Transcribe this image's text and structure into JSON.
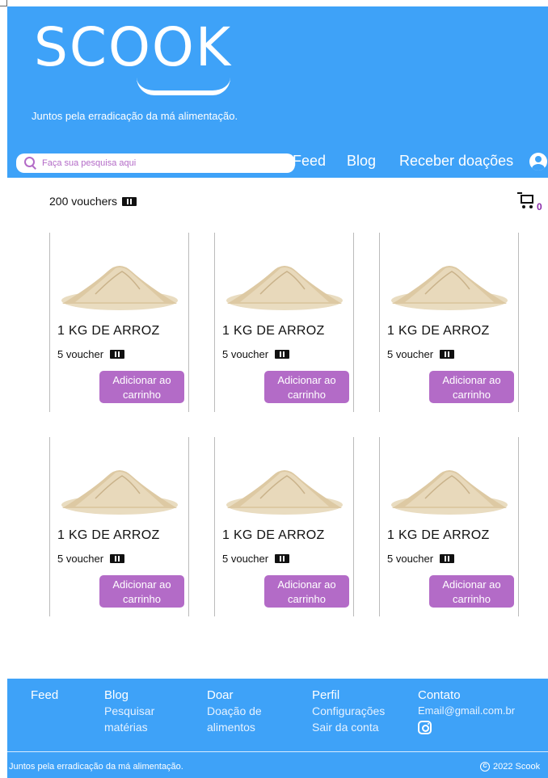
{
  "header": {
    "logo": "SCOOK",
    "tagline": "Juntos pela erradicação da má alimentação.",
    "search_placeholder": "Faça sua pesquisa aqui",
    "nav": [
      "Feed",
      "Blog",
      "Receber doações"
    ]
  },
  "wallet": {
    "vouchers_label": "200 vouchers",
    "cart_count": "0"
  },
  "products": [
    {
      "name": "1 KG DE ARROZ",
      "price": "5 voucher",
      "button": "Adicionar ao carrinho"
    },
    {
      "name": "1 KG DE ARROZ",
      "price": "5 voucher",
      "button": "Adicionar ao carrinho"
    },
    {
      "name": "1 KG DE ARROZ",
      "price": "5 voucher",
      "button": "Adicionar ao carrinho"
    },
    {
      "name": "1 KG DE ARROZ",
      "price": "5 voucher",
      "button": "Adicionar ao carrinho"
    },
    {
      "name": "1 KG DE ARROZ",
      "price": "5 voucher",
      "button": "Adicionar ao carrinho"
    },
    {
      "name": "1 KG DE ARROZ",
      "price": "5 voucher",
      "button": "Adicionar ao carrinho"
    }
  ],
  "footer": {
    "feed": "Feed",
    "blog": "Blog",
    "blog_link": "Pesquisar matérias",
    "doar": "Doar",
    "doar_link": "Doação de alimentos",
    "perfil": "Perfil",
    "perfil_link1": "Configurações",
    "perfil_link2": "Sair da conta",
    "contato": "Contato",
    "email": "Email@gmail.com.br",
    "tagline": "Juntos pela erradicação da má alimentação.",
    "copyright": "2022 Scook"
  },
  "colors": {
    "primary": "#3ea2f8",
    "accent": "#b36bc7"
  },
  "icons": [
    "search-icon",
    "user-icon",
    "voucher-ticket-icon",
    "cart-icon",
    "copyright-icon",
    "instagram-icon"
  ]
}
